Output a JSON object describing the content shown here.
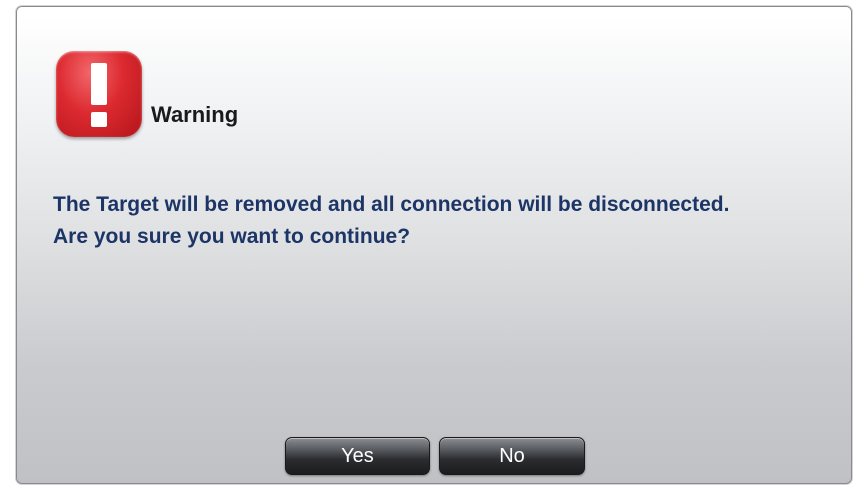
{
  "dialog": {
    "title": "Warning",
    "icon": "exclamation-warning-icon",
    "message": "The Target will be removed and all connection will be disconnected. Are you sure you want to continue?",
    "buttons": {
      "yes_label": "Yes",
      "no_label": "No"
    }
  },
  "colors": {
    "icon_red": "#dc2a30",
    "message_text": "#1c3466",
    "button_dark": "#2a2c2f"
  }
}
